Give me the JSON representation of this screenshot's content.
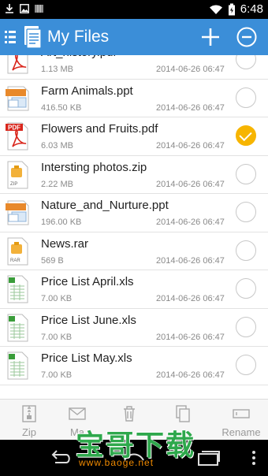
{
  "status_bar": {
    "time": "6:48"
  },
  "app_bar": {
    "title": "My Files"
  },
  "files": [
    {
      "name": "Art_history.pdf",
      "size": "1.13 MB",
      "date": "2014-06-26 06:47",
      "type": "pdf",
      "checked": false
    },
    {
      "name": "Farm Animals.ppt",
      "size": "416.50 KB",
      "date": "2014-06-26 06:47",
      "type": "ppt",
      "checked": false
    },
    {
      "name": "Flowers and Fruits.pdf",
      "size": "6.03 MB",
      "date": "2014-06-26 06:47",
      "type": "pdf",
      "checked": true
    },
    {
      "name": "Intersting photos.zip",
      "size": "2.22 MB",
      "date": "2014-06-26 06:47",
      "type": "zip",
      "checked": false
    },
    {
      "name": "Nature_and_Nurture.ppt",
      "size": "196.00 KB",
      "date": "2014-06-26 06:47",
      "type": "ppt",
      "checked": false
    },
    {
      "name": "News.rar",
      "size": "569 B",
      "date": "2014-06-26 06:47",
      "type": "rar",
      "checked": false
    },
    {
      "name": "Price List April.xls",
      "size": "7.00 KB",
      "date": "2014-06-26 06:47",
      "type": "xls",
      "checked": false
    },
    {
      "name": "Price List June.xls",
      "size": "7.00 KB",
      "date": "2014-06-26 06:47",
      "type": "xls",
      "checked": false
    },
    {
      "name": "Price List May.xls",
      "size": "7.00 KB",
      "date": "2014-06-26 06:47",
      "type": "xls",
      "checked": false
    }
  ],
  "icon_labels": {
    "pdf": "PDF",
    "zip": "ZIP",
    "rar": "RAR"
  },
  "toolbar": {
    "zip_label": "Zip",
    "mail_label": "Ma",
    "rename_label": "Rename"
  },
  "watermark": {
    "main": "宝哥下载",
    "url": "www.baoge.net"
  },
  "colors": {
    "accent": "#3b8ed8",
    "check": "#f7b500",
    "pdf": "#d9261c",
    "ppt": "#e8892b",
    "xls": "#3a9d3a"
  }
}
